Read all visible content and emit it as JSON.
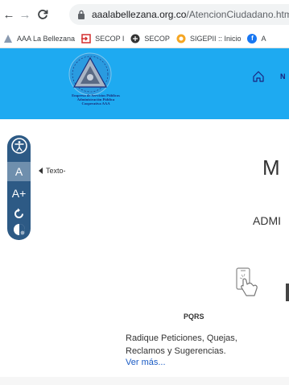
{
  "browser": {
    "url_domain": "aaalabellezana.org.co",
    "url_path": "/AtencionCiudadano.html",
    "bookmarks": [
      {
        "label": "AAA La Bellezana",
        "icon": "site-favicon-icon"
      },
      {
        "label": "SECOP I",
        "icon": "secop-icon"
      },
      {
        "label": "SECOP",
        "icon": "secop-circle-icon"
      },
      {
        "label": "SIGEPII :: Inicio",
        "icon": "sigep-icon"
      },
      {
        "label": "A",
        "icon": "facebook-icon"
      }
    ]
  },
  "header": {
    "logo_lines": [
      "Empresa de Servicios Públicos",
      "Administración Pública",
      "Cooperativa AAA"
    ],
    "nav_item_truncated": "N",
    "background_color": "#1eaaf1"
  },
  "accessibility": {
    "tooltip": "Texto-",
    "decrease_label": "A",
    "increase_label": "A+",
    "bar_color": "#2d5a85"
  },
  "main": {
    "title_truncated": "M",
    "subtitle_truncated": "ADMI",
    "pqrs": {
      "title": "PQRS",
      "description": "Radique Peticiones, Quejas, Reclamos y Sugerencias.",
      "link": "Ver más..."
    }
  }
}
